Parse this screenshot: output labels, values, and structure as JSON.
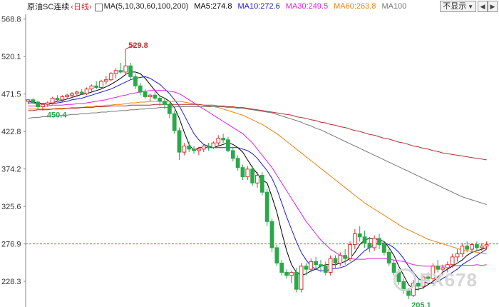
{
  "header": {
    "name": "原油SC连续",
    "period": "‹日线›",
    "ma_params": "MA(5,10,30,60,100,200)",
    "ma5_label": "MA5:274.8",
    "ma10_label": "MA10:272.6",
    "ma30_label": "MA30:249.5",
    "ma60_label": "MA60:263.8",
    "ma100_label": "MA100",
    "hide_button": "不显示",
    "prev_icon": "arrow-left-icon",
    "next_icon": "arrow-right-icon"
  },
  "colors": {
    "up": "#e03030",
    "down": "#2aa84a",
    "ma5": "#000000",
    "ma10": "#1a1ad6",
    "ma30": "#e020e0",
    "ma60": "#f08010",
    "ma100": "#777777",
    "ma200": "#b03030",
    "current_line": "#3a8ad6"
  },
  "chart_data": {
    "type": "candlestick",
    "y_ticks": [
      568.8,
      520.1,
      471.5,
      422.8,
      374.2,
      325.6,
      276.9,
      228.3
    ],
    "ylim": [
      195,
      575
    ],
    "current_price": 276.9,
    "annotations": [
      {
        "text": "529.8",
        "value": 529.8
      },
      {
        "text": "450.4",
        "value": 450.4
      },
      {
        "text": "205.1",
        "value": 205.1
      }
    ],
    "candles": [
      [
        462,
        465,
        458,
        464
      ],
      [
        464,
        466,
        459,
        461
      ],
      [
        461,
        463,
        452,
        455
      ],
      [
        455,
        460,
        450,
        458
      ],
      [
        458,
        462,
        455,
        460
      ],
      [
        460,
        468,
        458,
        466
      ],
      [
        466,
        470,
        462,
        464
      ],
      [
        464,
        470,
        461,
        468
      ],
      [
        468,
        472,
        465,
        470
      ],
      [
        470,
        474,
        466,
        472
      ],
      [
        472,
        476,
        468,
        474
      ],
      [
        474,
        478,
        470,
        472
      ],
      [
        472,
        480,
        470,
        478
      ],
      [
        478,
        484,
        475,
        482
      ],
      [
        482,
        488,
        478,
        480
      ],
      [
        480,
        490,
        478,
        488
      ],
      [
        488,
        495,
        484,
        490
      ],
      [
        490,
        500,
        488,
        498
      ],
      [
        498,
        505,
        492,
        502
      ],
      [
        502,
        512,
        498,
        500
      ],
      [
        500,
        530,
        496,
        508
      ],
      [
        508,
        512,
        490,
        494
      ],
      [
        494,
        498,
        478,
        482
      ],
      [
        482,
        486,
        470,
        474
      ],
      [
        474,
        478,
        465,
        468
      ],
      [
        468,
        472,
        462,
        470
      ],
      [
        470,
        474,
        464,
        466
      ],
      [
        466,
        470,
        456,
        462
      ],
      [
        462,
        466,
        452,
        458
      ],
      [
        458,
        460,
        440,
        446
      ],
      [
        446,
        450,
        420,
        424
      ],
      [
        424,
        428,
        386,
        396
      ],
      [
        396,
        408,
        392,
        404
      ],
      [
        404,
        410,
        396,
        400
      ],
      [
        400,
        404,
        394,
        398
      ],
      [
        398,
        402,
        392,
        400
      ],
      [
        400,
        406,
        396,
        404
      ],
      [
        404,
        408,
        398,
        402
      ],
      [
        402,
        410,
        400,
        408
      ],
      [
        408,
        418,
        404,
        414
      ],
      [
        414,
        420,
        408,
        412
      ],
      [
        412,
        416,
        396,
        398
      ],
      [
        398,
        402,
        384,
        388
      ],
      [
        388,
        392,
        372,
        376
      ],
      [
        376,
        380,
        360,
        364
      ],
      [
        364,
        378,
        360,
        374
      ],
      [
        374,
        378,
        352,
        356
      ],
      [
        356,
        370,
        350,
        366
      ],
      [
        366,
        370,
        340,
        344
      ],
      [
        344,
        348,
        300,
        306
      ],
      [
        306,
        310,
        266,
        272
      ],
      [
        272,
        276,
        248,
        252
      ],
      [
        252,
        256,
        236,
        240
      ],
      [
        240,
        244,
        232,
        236
      ],
      [
        236,
        242,
        226,
        240
      ],
      [
        240,
        246,
        214,
        218
      ],
      [
        218,
        252,
        214,
        248
      ],
      [
        248,
        252,
        236,
        244
      ],
      [
        244,
        258,
        240,
        254
      ],
      [
        254,
        260,
        244,
        250
      ],
      [
        250,
        256,
        240,
        248
      ],
      [
        248,
        254,
        236,
        240
      ],
      [
        240,
        262,
        236,
        258
      ],
      [
        258,
        262,
        246,
        252
      ],
      [
        252,
        266,
        248,
        262
      ],
      [
        262,
        270,
        250,
        258
      ],
      [
        258,
        280,
        254,
        276
      ],
      [
        276,
        296,
        270,
        290
      ],
      [
        290,
        300,
        280,
        286
      ],
      [
        286,
        294,
        272,
        278
      ],
      [
        278,
        286,
        266,
        272
      ],
      [
        272,
        288,
        268,
        284
      ],
      [
        284,
        290,
        270,
        276
      ],
      [
        276,
        280,
        262,
        266
      ],
      [
        266,
        270,
        248,
        252
      ],
      [
        252,
        256,
        236,
        240
      ],
      [
        240,
        244,
        224,
        228
      ],
      [
        228,
        232,
        212,
        216
      ],
      [
        216,
        220,
        205,
        210
      ],
      [
        210,
        230,
        208,
        226
      ],
      [
        226,
        232,
        216,
        222
      ],
      [
        222,
        238,
        218,
        234
      ],
      [
        234,
        240,
        228,
        232
      ],
      [
        232,
        252,
        228,
        248
      ],
      [
        248,
        256,
        240,
        244
      ],
      [
        244,
        250,
        236,
        246
      ],
      [
        246,
        254,
        240,
        250
      ],
      [
        250,
        264,
        246,
        260
      ],
      [
        260,
        270,
        254,
        264
      ],
      [
        264,
        278,
        260,
        274
      ],
      [
        274,
        280,
        266,
        270
      ],
      [
        270,
        278,
        266,
        276
      ],
      [
        276,
        280,
        268,
        272
      ],
      [
        272,
        278,
        268,
        274
      ],
      [
        274,
        280,
        270,
        276
      ]
    ],
    "ma_series": [
      {
        "name": "MA5",
        "values": [
          462,
          461,
          460,
          459,
          459,
          460,
          462,
          463,
          465,
          467,
          469,
          471,
          472,
          474,
          476,
          478,
          481,
          484,
          488,
          492,
          497,
          500,
          500,
          498,
          492,
          484,
          476,
          469,
          466,
          462,
          454,
          440,
          422,
          406,
          398,
          402,
          402,
          402,
          402,
          404,
          406,
          408,
          406,
          402,
          396,
          386,
          376,
          368,
          360,
          356,
          338,
          318,
          292,
          268,
          250,
          240,
          236,
          238,
          242,
          244,
          248,
          250,
          250,
          250,
          252,
          254,
          258,
          266,
          276,
          282,
          284,
          284,
          282,
          280,
          272,
          262,
          248,
          236,
          224,
          218,
          218,
          220,
          224,
          228,
          234,
          240,
          244,
          248,
          252,
          256,
          262,
          266,
          268,
          270,
          272
        ]
      },
      {
        "name": "MA10",
        "values": [
          460,
          460,
          459,
          459,
          459,
          459,
          460,
          461,
          462,
          464,
          465,
          466,
          468,
          470,
          472,
          474,
          476,
          478,
          481,
          484,
          487,
          490,
          492,
          493,
          494,
          492,
          488,
          484,
          478,
          472,
          464,
          456,
          444,
          432,
          420,
          412,
          406,
          404,
          402,
          402,
          402,
          402,
          402,
          402,
          400,
          398,
          394,
          388,
          380,
          372,
          362,
          348,
          330,
          312,
          296,
          280,
          266,
          256,
          248,
          244,
          242,
          242,
          244,
          245,
          246,
          248,
          252,
          256,
          262,
          268,
          272,
          276,
          278,
          278,
          276,
          272,
          266,
          258,
          248,
          240,
          232,
          228,
          226,
          226,
          228,
          232,
          236,
          240,
          244,
          250,
          254,
          258,
          262,
          266,
          270
        ]
      },
      {
        "name": "MA30",
        "values": [
          456,
          456,
          456,
          456,
          456,
          457,
          457,
          457,
          458,
          458,
          459,
          459,
          460,
          461,
          462,
          463,
          464,
          466,
          467,
          469,
          470,
          472,
          473,
          474,
          475,
          476,
          476,
          476,
          476,
          475,
          474,
          472,
          468,
          464,
          460,
          456,
          452,
          448,
          444,
          440,
          436,
          432,
          428,
          424,
          420,
          414,
          408,
          400,
          392,
          384,
          376,
          366,
          356,
          346,
          336,
          326,
          316,
          306,
          298,
          290,
          282,
          276,
          270,
          266,
          262,
          260,
          258,
          257,
          257,
          257,
          258,
          258,
          258,
          258,
          257,
          256,
          255,
          254,
          252,
          250,
          249,
          248,
          248,
          248,
          248,
          248,
          248,
          248,
          249,
          249,
          249,
          249,
          250,
          249,
          250
        ]
      },
      {
        "name": "MA60",
        "values": [
          452,
          452,
          452,
          452,
          452,
          452,
          453,
          453,
          453,
          454,
          454,
          454,
          455,
          455,
          456,
          456,
          457,
          457,
          458,
          458,
          459,
          460,
          460,
          461,
          461,
          462,
          462,
          462,
          462,
          462,
          462,
          462,
          461,
          460,
          459,
          458,
          457,
          456,
          455,
          454,
          452,
          450,
          448,
          446,
          444,
          441,
          438,
          435,
          432,
          428,
          424,
          420,
          415,
          410,
          405,
          400,
          395,
          390,
          385,
          380,
          375,
          370,
          365,
          360,
          355,
          350,
          345,
          340,
          335,
          330,
          326,
          322,
          318,
          314,
          310,
          306,
          302,
          298,
          295,
          292,
          289,
          286,
          283,
          281,
          279,
          277,
          275,
          273,
          271,
          269,
          268,
          267,
          266,
          265,
          264
        ]
      },
      {
        "name": "MA100",
        "values": [
          440,
          441,
          441,
          442,
          442,
          443,
          443,
          444,
          444,
          445,
          445,
          446,
          446,
          447,
          447,
          448,
          448,
          449,
          449,
          450,
          450,
          451,
          451,
          452,
          452,
          453,
          453,
          454,
          454,
          454,
          455,
          455,
          455,
          455,
          455,
          455,
          455,
          455,
          455,
          455,
          455,
          454,
          454,
          453,
          453,
          452,
          451,
          450,
          449,
          448,
          447,
          445,
          443,
          441,
          439,
          437,
          435,
          432,
          430,
          427,
          425,
          422,
          419,
          416,
          413,
          410,
          407,
          404,
          401,
          398,
          395,
          392,
          389,
          386,
          383,
          380,
          377,
          374,
          371,
          368,
          365,
          362,
          359,
          356,
          353,
          350,
          347,
          344,
          341,
          338,
          336,
          334,
          332,
          330,
          328
        ]
      },
      {
        "name": "MA200",
        "values": [
          450,
          450,
          451,
          451,
          451,
          452,
          452,
          452,
          453,
          453,
          453,
          454,
          454,
          454,
          455,
          455,
          455,
          456,
          456,
          456,
          456,
          457,
          457,
          457,
          457,
          457,
          458,
          458,
          458,
          458,
          458,
          458,
          458,
          458,
          458,
          458,
          457,
          457,
          457,
          456,
          456,
          455,
          455,
          454,
          454,
          453,
          452,
          451,
          450,
          449,
          448,
          447,
          446,
          445,
          444,
          442,
          441,
          440,
          438,
          437,
          435,
          434,
          432,
          431,
          429,
          428,
          426,
          424,
          423,
          421,
          419,
          418,
          416,
          414,
          413,
          411,
          409,
          408,
          406,
          404,
          403,
          401,
          400,
          398,
          397,
          395,
          394,
          393,
          392,
          391,
          390,
          389,
          388,
          387,
          386
        ]
      }
    ]
  },
  "watermark": "FX678"
}
